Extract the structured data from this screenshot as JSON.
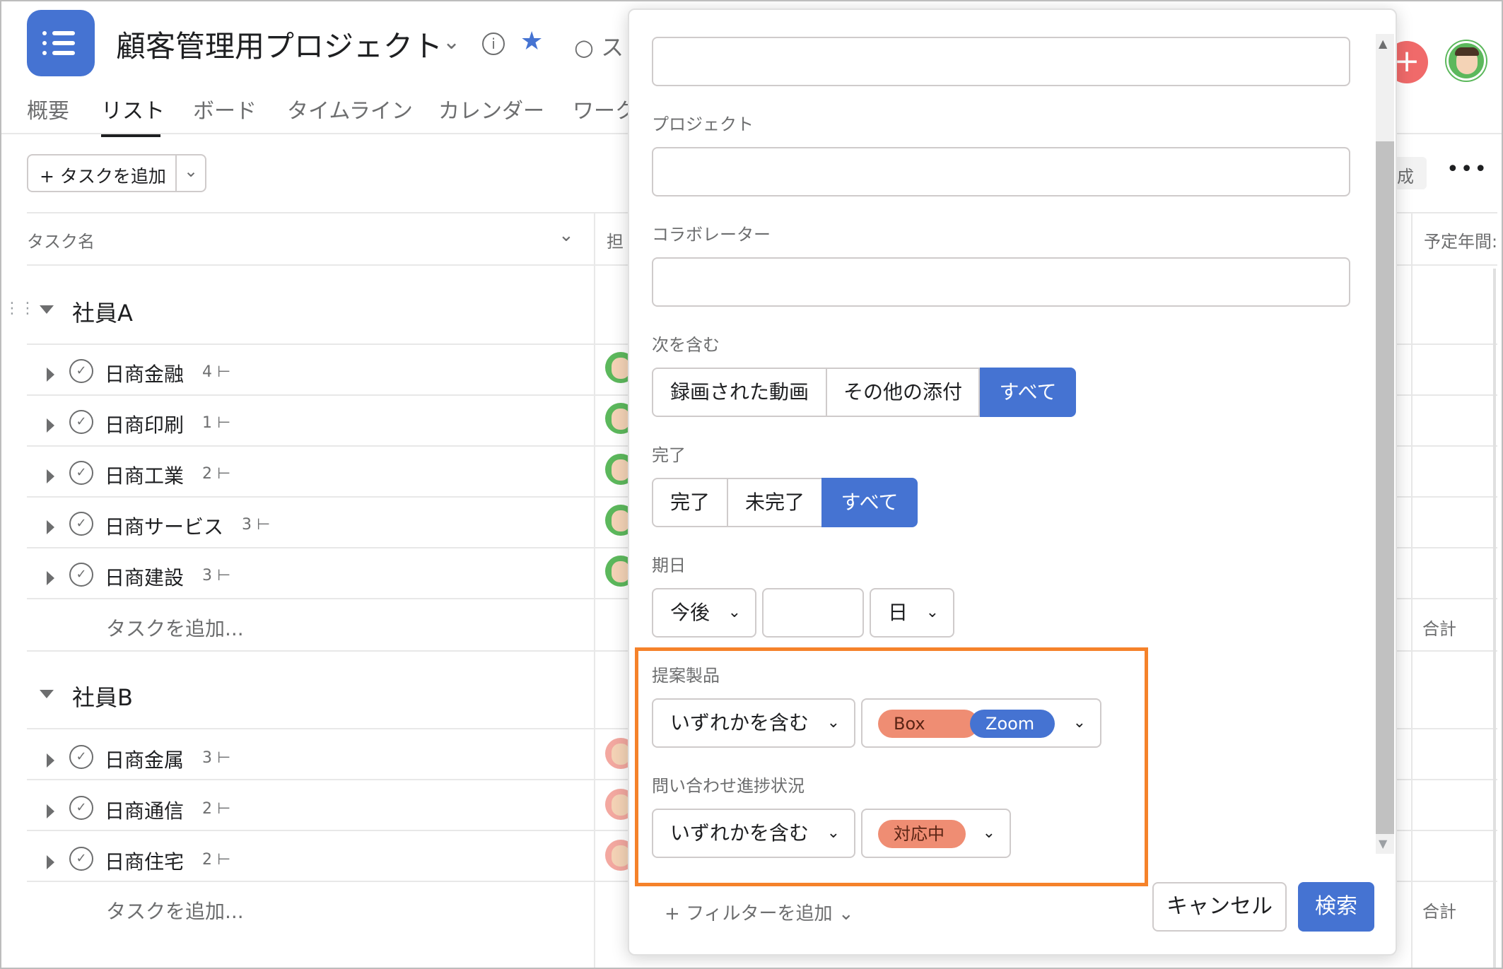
{
  "header": {
    "project_title": "顧客管理用プロジェクト",
    "status_partial": "○ ス",
    "tabs": [
      {
        "label": "概要"
      },
      {
        "label": "リスト"
      },
      {
        "label": "ボード"
      },
      {
        "label": "タイムライン"
      },
      {
        "label": "カレンダー"
      },
      {
        "label": "ワーク"
      }
    ],
    "add_icon": "plus-icon",
    "star_color": "#4573d2"
  },
  "toolbar": {
    "add_task_label": "タスクを追加",
    "partial_button_label": "成"
  },
  "table": {
    "col_task_name": "タスク名",
    "col_assignee_partial": "担",
    "col_annual_partial": "予定年間:",
    "sections": [
      {
        "title": "社員A",
        "tasks": [
          {
            "name": "日商金融",
            "subtasks": "4"
          },
          {
            "name": "日商印刷",
            "subtasks": "1"
          },
          {
            "name": "日商工業",
            "subtasks": "2"
          },
          {
            "name": "日商サービス",
            "subtasks": "3"
          },
          {
            "name": "日商建設",
            "subtasks": "3"
          }
        ],
        "add_task": "タスクを追加...",
        "total": "合計"
      },
      {
        "title": "社員B",
        "tasks": [
          {
            "name": "日商金属",
            "subtasks": "3"
          },
          {
            "name": "日商通信",
            "subtasks": "2"
          },
          {
            "name": "日商住宅",
            "subtasks": "2"
          }
        ],
        "add_task": "タスクを追加...",
        "total": "合計"
      }
    ]
  },
  "dialog": {
    "project_label": "プロジェクト",
    "collaborator_label": "コラボレーター",
    "includes_label": "次を含む",
    "includes_options": [
      "録画された動画",
      "その他の添付",
      "すべて"
    ],
    "includes_selected": "すべて",
    "completion_label": "完了",
    "completion_options": [
      "完了",
      "未完了",
      "すべて"
    ],
    "completion_selected": "すべて",
    "due_label": "期日",
    "due_relative": "今後",
    "due_number": "",
    "due_unit": "日",
    "product_label": "提案製品",
    "product_operator": "いずれかを含む",
    "product_values": [
      "Box",
      "Zoom"
    ],
    "inquiry_label": "問い合わせ進捗状況",
    "inquiry_operator": "いずれかを含む",
    "inquiry_values": [
      "対応中"
    ],
    "add_filter": "フィルターを追加",
    "cancel": "キャンセル",
    "search": "検索",
    "highlight_color": "#f5822a",
    "accent": "#4573d2"
  }
}
